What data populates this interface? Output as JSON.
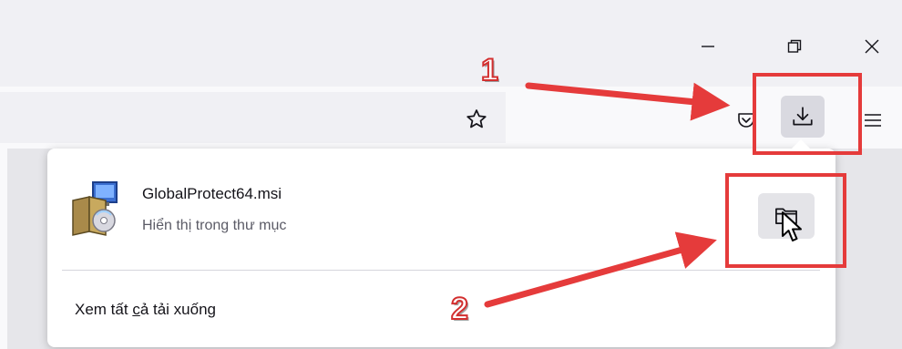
{
  "window": {
    "controls": {
      "minimize_icon": "minimize-icon",
      "restore_icon": "restore-icon",
      "close_icon": "close-icon"
    }
  },
  "toolbar": {
    "bookmark_icon": "star-icon",
    "pocket_icon": "pocket-icon",
    "downloads_icon": "download-icon",
    "menu_icon": "hamburger-menu-icon"
  },
  "downloads_panel": {
    "item": {
      "file_name": "GlobalProtect64.msi",
      "status": "Hiển thị trong thư mục",
      "file_icon": "installer-package-icon",
      "action_icon": "folder-icon"
    },
    "show_all": {
      "before": "Xem tất ",
      "accesskey": "c",
      "after": "ả tải xuống"
    }
  },
  "annotations": {
    "step1_label": "1",
    "step2_label": "2",
    "color": "#e53b3b"
  },
  "colors": {
    "titlebar": "#f0f0f4",
    "navbar": "#f9f9fb",
    "button_active": "#d9d9e0"
  }
}
